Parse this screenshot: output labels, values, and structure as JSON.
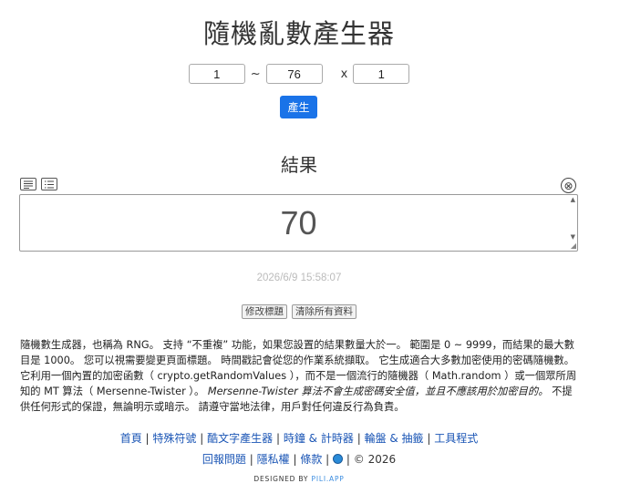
{
  "title": "隨機亂數產生器",
  "range": {
    "min": "1",
    "separator": "~",
    "max": "76",
    "times_sign": "x",
    "count": "1"
  },
  "generate_label": "產生",
  "result": {
    "title": "結果",
    "value": "70",
    "close_symbol": "⊗"
  },
  "timestamp": "2026/6/9 15:58:07",
  "actions": {
    "edit_title": "修改標題",
    "clear_all": "清除所有資料"
  },
  "description": {
    "p1": "隨機數生成器，也稱為 RNG。 支持 “不重複” 功能，如果您設置的結果數量大於一。 範圍是 0 ~ 9999，而結果的最大數目是 1000。 您可以視需要變更頁面標題。 時間戳記會從您的作業系統擷取。 它生成適合大多數加密使用的密碼隨機數。 它利用一個內置的加密函數（ crypto.getRandomValues ），而不是一個流行的隨機器（ Math.random ）或一個眾所周知的 MT 算法（ Mersenne-Twister ）。",
    "italic": "Mersenne-Twister 算法不會生成密碼安全值，並且不應該用於加密目的。",
    "p2": " 不提供任何形式的保證，無論明示或暗示。 請遵守當地法律，用戶對任何違反行為負責。"
  },
  "footer": {
    "links1": [
      "首頁",
      "特殊符號",
      "酷文字產生器",
      "時鐘 & 計時器",
      "輪盤 & 抽籤",
      "工具程式"
    ],
    "divider": "|",
    "links2": [
      "回報問題",
      "隱私權",
      "條款"
    ],
    "copyright": "© 2026",
    "designed_by": "DESIGNED BY",
    "brand": "PILI.APP"
  },
  "colors": {
    "accent": "#1a73e8",
    "link": "#1a55b5",
    "brand": "#3c8de0"
  },
  "icons": {
    "text_view": "text-view-icon",
    "list_view": "list-view-icon",
    "close": "close-icon",
    "language": "globe-icon"
  }
}
